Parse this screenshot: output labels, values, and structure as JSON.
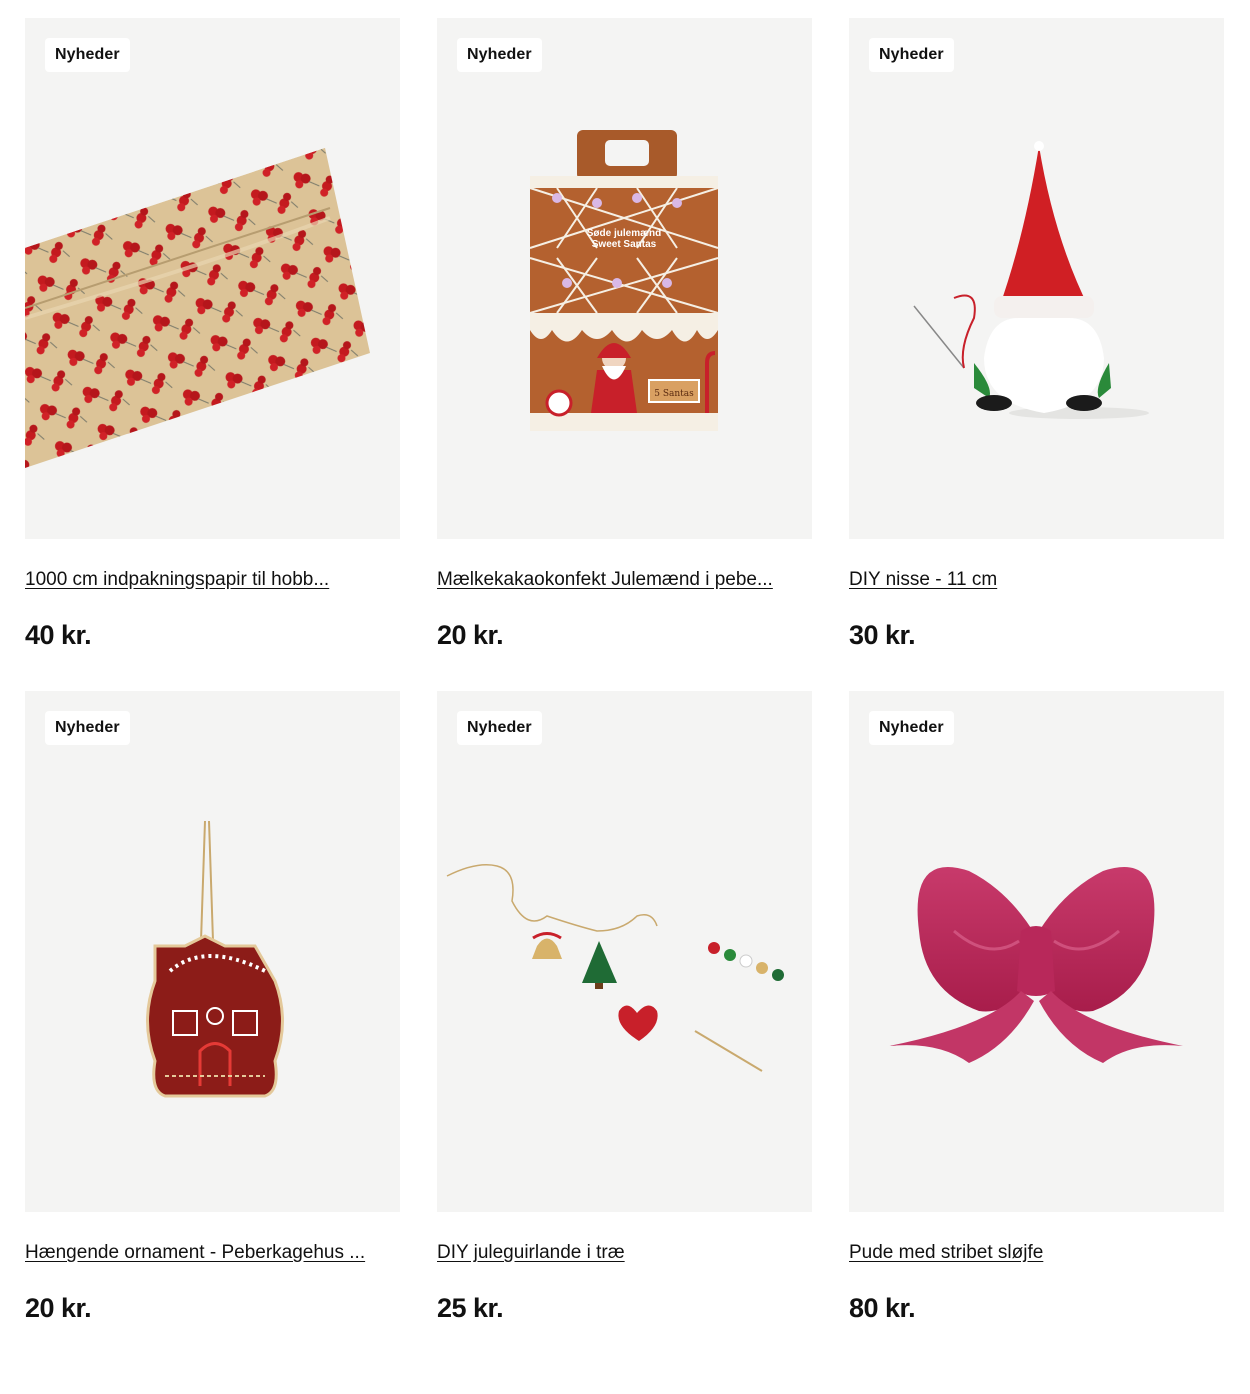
{
  "products": [
    {
      "badge": "Nyheder",
      "title": "1000 cm indpakningspapir til hobb...",
      "price": "40 kr.",
      "image": "berry-wrapping-paper-roll"
    },
    {
      "badge": "Nyheder",
      "title": "Mælkekakaokonfekt Julemænd i pebe...",
      "price": "20 kr.",
      "image": "gingerbread-box-santa",
      "image_text": {
        "line1": "Søde julemænd",
        "line2": "Sweet Santas",
        "sign": "5 Santas"
      }
    },
    {
      "badge": "Nyheder",
      "title": "DIY nisse - 11 cm",
      "price": "30 kr.",
      "image": "felt-gnome"
    },
    {
      "badge": "Nyheder",
      "title": "Hængende ornament - Peberkagehus ...",
      "price": "20 kr.",
      "image": "gingerbread-house-ornament"
    },
    {
      "badge": "Nyheder",
      "title": "DIY juleguirlande i træ",
      "price": "25 kr.",
      "image": "wooden-garland-kit"
    },
    {
      "badge": "Nyheder",
      "title": "Pude med stribet sløjfe",
      "price": "80 kr.",
      "image": "pink-bow-cushion"
    }
  ],
  "colors": {
    "card_bg": "#f4f4f3",
    "text": "#111111",
    "badge_bg": "#ffffff"
  }
}
